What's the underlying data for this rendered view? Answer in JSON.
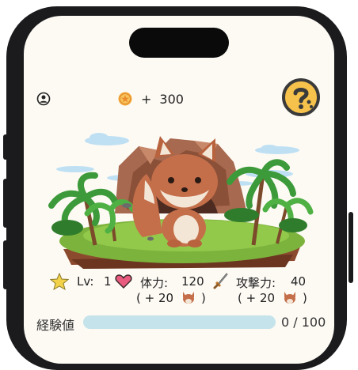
{
  "header": {
    "plus": "+",
    "coins": "300",
    "profile_icon": "person-circle-icon",
    "coin_icon": "coin-icon",
    "help_icon": "question-mark-icon"
  },
  "scene": {
    "character": "fox-character"
  },
  "stats": {
    "lv_label": "Lv:",
    "lv_value": "1",
    "hp_label": "体力:",
    "hp_value": "120",
    "hp_bonus_open": "( + 20",
    "hp_bonus_close": ")",
    "atk_label": "攻撃力:",
    "atk_value": "40",
    "atk_bonus_open": "( + 20",
    "atk_bonus_close": ")"
  },
  "experience": {
    "label": "経験値",
    "current": 0,
    "max": 100,
    "display": "0 / 100",
    "fill_fraction": 0
  },
  "colors": {
    "background": "#fdfaf4",
    "help_button": "#f6c24c",
    "exp_bar": "#c5e3ea"
  }
}
